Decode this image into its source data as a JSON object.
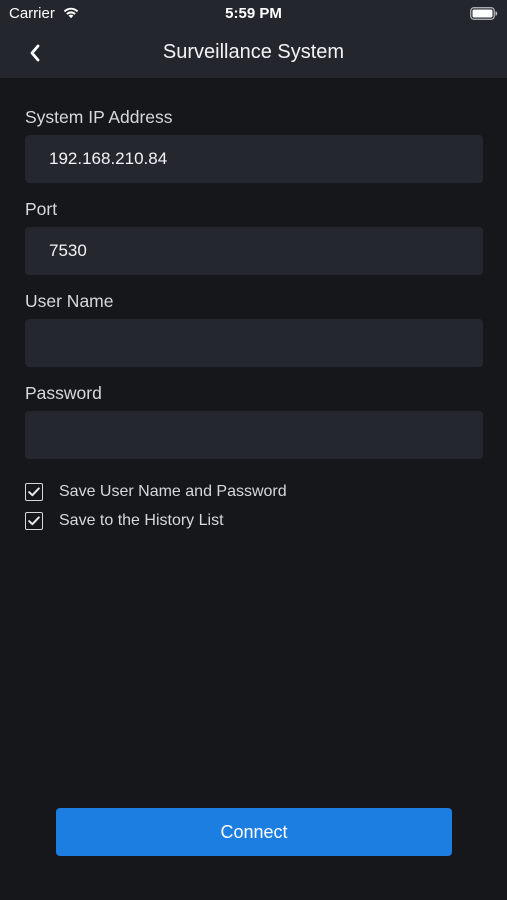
{
  "status_bar": {
    "carrier": "Carrier",
    "time": "5:59 PM",
    "wifi_icon": "wifi-icon",
    "battery_icon": "battery-icon"
  },
  "nav": {
    "title": "Surveillance System",
    "back_icon": "chevron-left-icon"
  },
  "form": {
    "ip": {
      "label": "System IP Address",
      "value": "192.168.210.84",
      "placeholder": ""
    },
    "port": {
      "label": "Port",
      "value": "7530",
      "placeholder": ""
    },
    "username": {
      "label": "User Name",
      "value": "",
      "placeholder": ""
    },
    "password": {
      "label": "Password",
      "value": "",
      "placeholder": ""
    }
  },
  "options": [
    {
      "label": "Save User Name and Password",
      "checked": true
    },
    {
      "label": "Save to the History List",
      "checked": true
    }
  ],
  "connect_label": "Connect",
  "colors": {
    "background": "#16171b",
    "bar": "#23262d",
    "input": "#24272e",
    "accent": "#1c7ee0"
  }
}
